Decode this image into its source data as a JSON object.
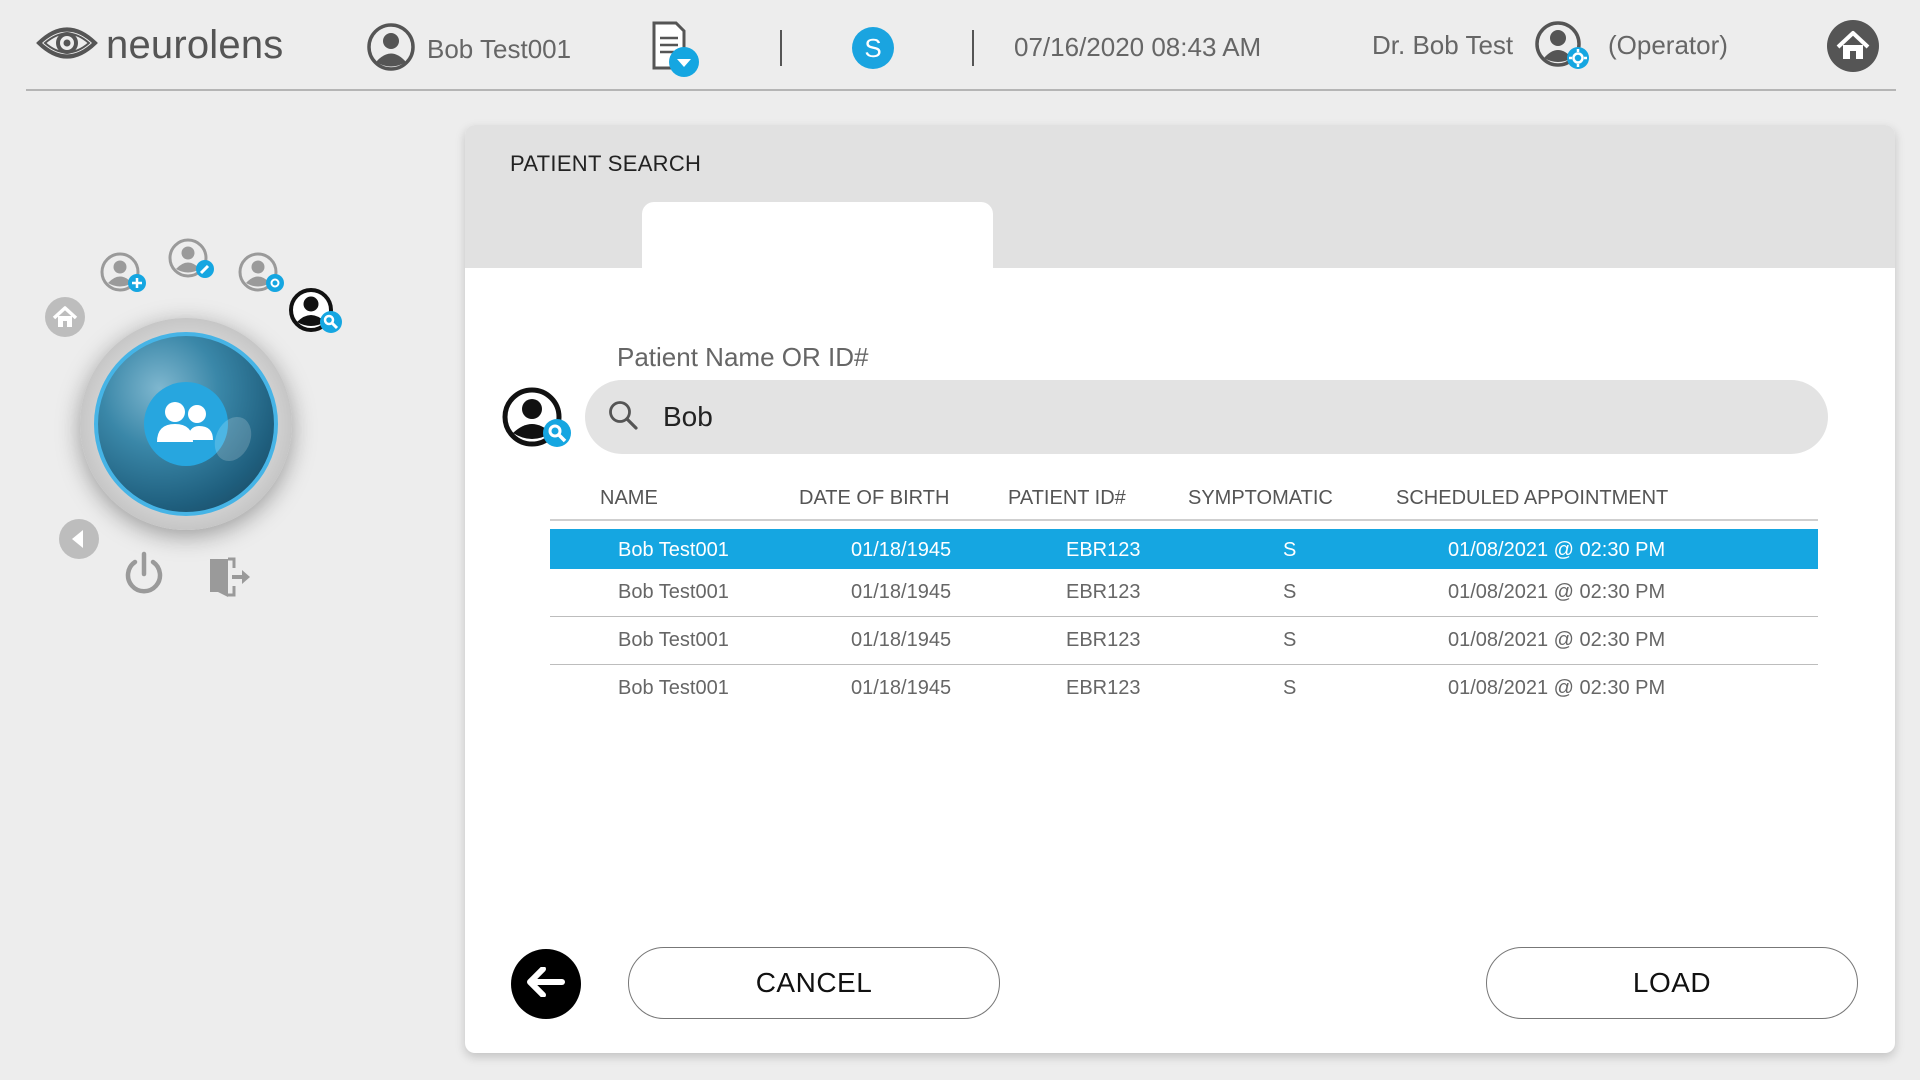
{
  "app": {
    "logo_text": "neurolens"
  },
  "header": {
    "patient_name": "Bob Test001",
    "status_badge": "S",
    "datetime": "07/16/2020 08:43 AM",
    "doctor_name": "Dr. Bob Test",
    "role": "(Operator)"
  },
  "panel": {
    "title": "PATIENT SEARCH",
    "search": {
      "label": "Patient Name OR ID#",
      "value": "Bob"
    },
    "table": {
      "columns": {
        "name": "NAME",
        "dob": "DATE OF BIRTH",
        "pid": "PATIENT ID#",
        "sym": "SYMPTOMATIC",
        "appt": "SCHEDULED APPOINTMENT"
      },
      "rows": [
        {
          "name": "Bob Test001",
          "dob": "01/18/1945",
          "pid": "EBR123",
          "sym": "S",
          "appt": "01/08/2021  @ 02:30 PM"
        },
        {
          "name": "Bob Test001",
          "dob": "01/18/1945",
          "pid": "EBR123",
          "sym": "S",
          "appt": "01/08/2021  @ 02:30 PM"
        },
        {
          "name": "Bob Test001",
          "dob": "01/18/1945",
          "pid": "EBR123",
          "sym": "S",
          "appt": "01/08/2021  @ 02:30 PM"
        },
        {
          "name": "Bob Test001",
          "dob": "01/18/1945",
          "pid": "EBR123",
          "sym": "S",
          "appt": "01/08/2021  @ 02:30 PM"
        }
      ]
    },
    "buttons": {
      "cancel": "CANCEL",
      "load": "LOAD"
    }
  },
  "icons": {
    "logo": "eye-icon",
    "patient": "user-icon",
    "report": "document-dropdown-icon",
    "operator": "user-settings-icon",
    "home": "home-icon",
    "orb": "patients-icon",
    "search": "search-icon",
    "back": "arrow-left-icon",
    "power": "power-icon",
    "logout": "exit-door-icon"
  },
  "colors": {
    "accent": "#15a6e1",
    "panel_header": "#e1e1e1",
    "background": "#ededed"
  }
}
